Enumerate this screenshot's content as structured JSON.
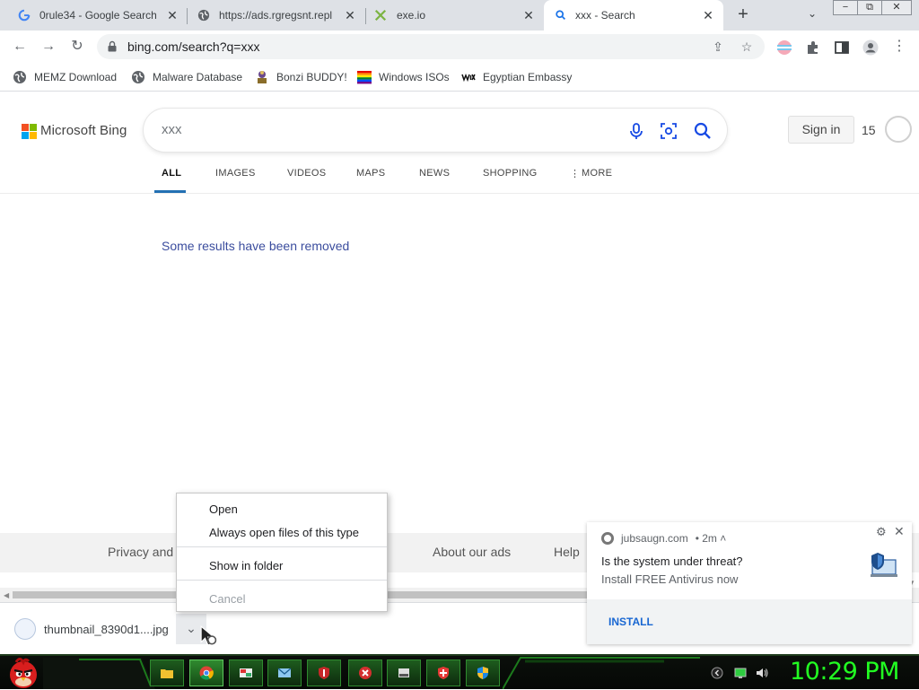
{
  "browser": {
    "tabs": [
      {
        "title": "0rule34 - Google Search",
        "favicon": "google-g-icon"
      },
      {
        "title": "https://ads.rgregsnt.repl.c",
        "favicon": "globe-icon"
      },
      {
        "title": "exe.io",
        "favicon": "exe-io-icon"
      },
      {
        "title": "xxx - Search",
        "favicon": "bing-search-icon",
        "active": true
      }
    ],
    "new_tab": "+",
    "window_controls": [
      "−",
      "⧉",
      "✕"
    ],
    "url": "bing.com/search?q=xxx",
    "bookmarks": [
      {
        "label": "MEMZ Download",
        "icon": "globe-icon"
      },
      {
        "label": "Malware Database",
        "icon": "globe-icon"
      },
      {
        "label": "Bonzi BUDDY!",
        "icon": "bonzi-icon"
      },
      {
        "label": "Windows ISOs",
        "icon": "windows-flag-icon"
      },
      {
        "label": "Egyptian Embassy",
        "icon": "wix-icon"
      }
    ]
  },
  "bing": {
    "logo_text": "Microsoft Bing",
    "query": "xxx",
    "sign_in": "Sign in",
    "points": "15",
    "nav": [
      "ALL",
      "IMAGES",
      "VIDEOS",
      "MAPS",
      "NEWS",
      "SHOPPING",
      "MORE"
    ],
    "active_nav": "ALL",
    "more_icon": "⋮",
    "removed_notice": "Some results have been removed",
    "footer": {
      "privacy": "Privacy and",
      "about_ads": "About our ads",
      "help": "Help"
    }
  },
  "download": {
    "filename": "thumbnail_8390d1....jpg",
    "chevron": "⌄"
  },
  "context_menu": {
    "open": "Open",
    "always_open": "Always open files of this type",
    "show_in_folder": "Show in folder",
    "cancel": "Cancel"
  },
  "notification": {
    "source": "jubsaugn.com",
    "age": "• 2m ˄",
    "title": "Is the system under threat?",
    "body": "Install FREE Antivirus now",
    "action": "INSTALL",
    "close": "✕",
    "settings": "⚙"
  },
  "taskbar": {
    "clock": "10:29 PM",
    "buttons": [
      "folder-icon",
      "chrome-icon",
      "photos-icon",
      "mail-icon",
      "shield-icon",
      "error-icon",
      "drive-icon",
      "antivirus-icon",
      "security-shield-icon"
    ],
    "colors": {
      "accent": "#22ff22",
      "button": "#1e5c1e"
    }
  },
  "colors": {
    "bing_blue": "#2370b3",
    "link": "#1967d2",
    "tabstrip": "#dee1e6"
  }
}
